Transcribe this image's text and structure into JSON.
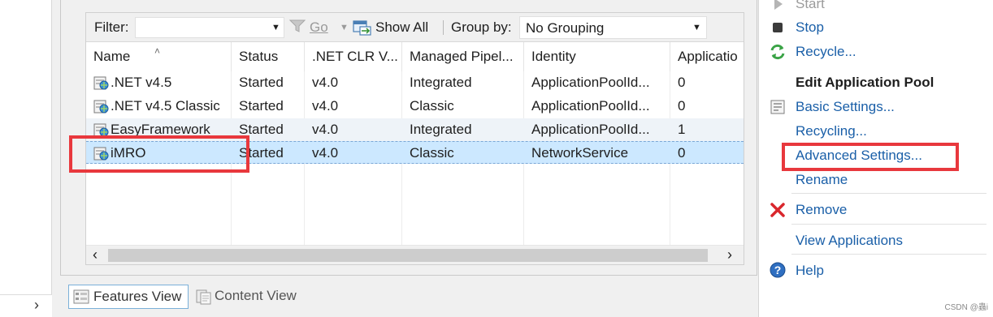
{
  "filter_bar": {
    "filter_label": "Filter:",
    "filter_value": "",
    "go_label": "Go",
    "show_all_label": "Show All",
    "group_by_label": "Group by:",
    "grouping_value": "No Grouping"
  },
  "columns": [
    "Name",
    "Status",
    ".NET CLR V...",
    "Managed Pipel...",
    "Identity",
    "Applicatio"
  ],
  "app_pools": [
    {
      "name": ".NET v4.5",
      "status": "Started",
      "clr": "v4.0",
      "pipeline": "Integrated",
      "identity": "ApplicationPoolId...",
      "apps": "0"
    },
    {
      "name": ".NET v4.5 Classic",
      "status": "Started",
      "clr": "v4.0",
      "pipeline": "Classic",
      "identity": "ApplicationPoolId...",
      "apps": "0"
    },
    {
      "name": "EasyFramework",
      "status": "Started",
      "clr": "v4.0",
      "pipeline": "Integrated",
      "identity": "ApplicationPoolId...",
      "apps": "1"
    },
    {
      "name": "iMRO",
      "status": "Started",
      "clr": "v4.0",
      "pipeline": "Classic",
      "identity": "NetworkService",
      "apps": "0"
    }
  ],
  "view_tabs": {
    "features": "Features View",
    "content": "Content View"
  },
  "actions": {
    "start": "Start",
    "stop": "Stop",
    "recycle": "Recycle...",
    "edit_header": "Edit Application Pool",
    "basic_settings": "Basic Settings...",
    "recycling": "Recycling...",
    "advanced_settings": "Advanced Settings...",
    "rename": "Rename",
    "remove": "Remove",
    "view_applications": "View Applications",
    "help": "Help"
  },
  "watermark": "CSDN @蟲i"
}
